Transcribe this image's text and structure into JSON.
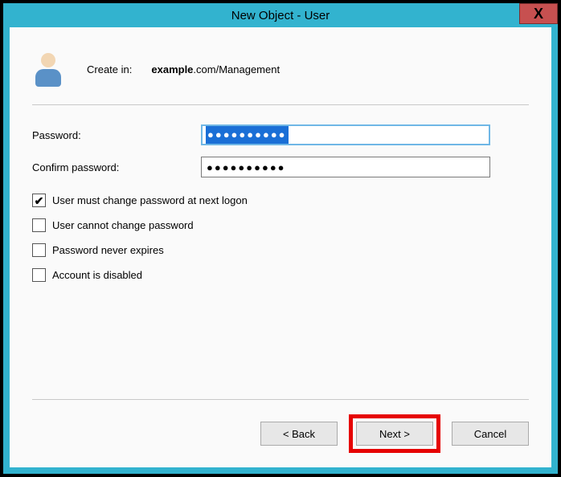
{
  "title": "New Object - User",
  "header": {
    "create_in_label": "Create in:",
    "domain": "example",
    "path_rest": ".com/Management"
  },
  "fields": {
    "password_label": "Password:",
    "password_value": "●●●●●●●●●●",
    "confirm_label": "Confirm password:",
    "confirm_value": "●●●●●●●●●●"
  },
  "options": {
    "must_change": {
      "label": "User must change password at next logon",
      "checked": true
    },
    "cannot_change": {
      "label": "User cannot change password",
      "checked": false
    },
    "never_expires": {
      "label": "Password never expires",
      "checked": false
    },
    "disabled": {
      "label": "Account is disabled",
      "checked": false
    }
  },
  "buttons": {
    "back": "< Back",
    "next": "Next >",
    "cancel": "Cancel"
  }
}
